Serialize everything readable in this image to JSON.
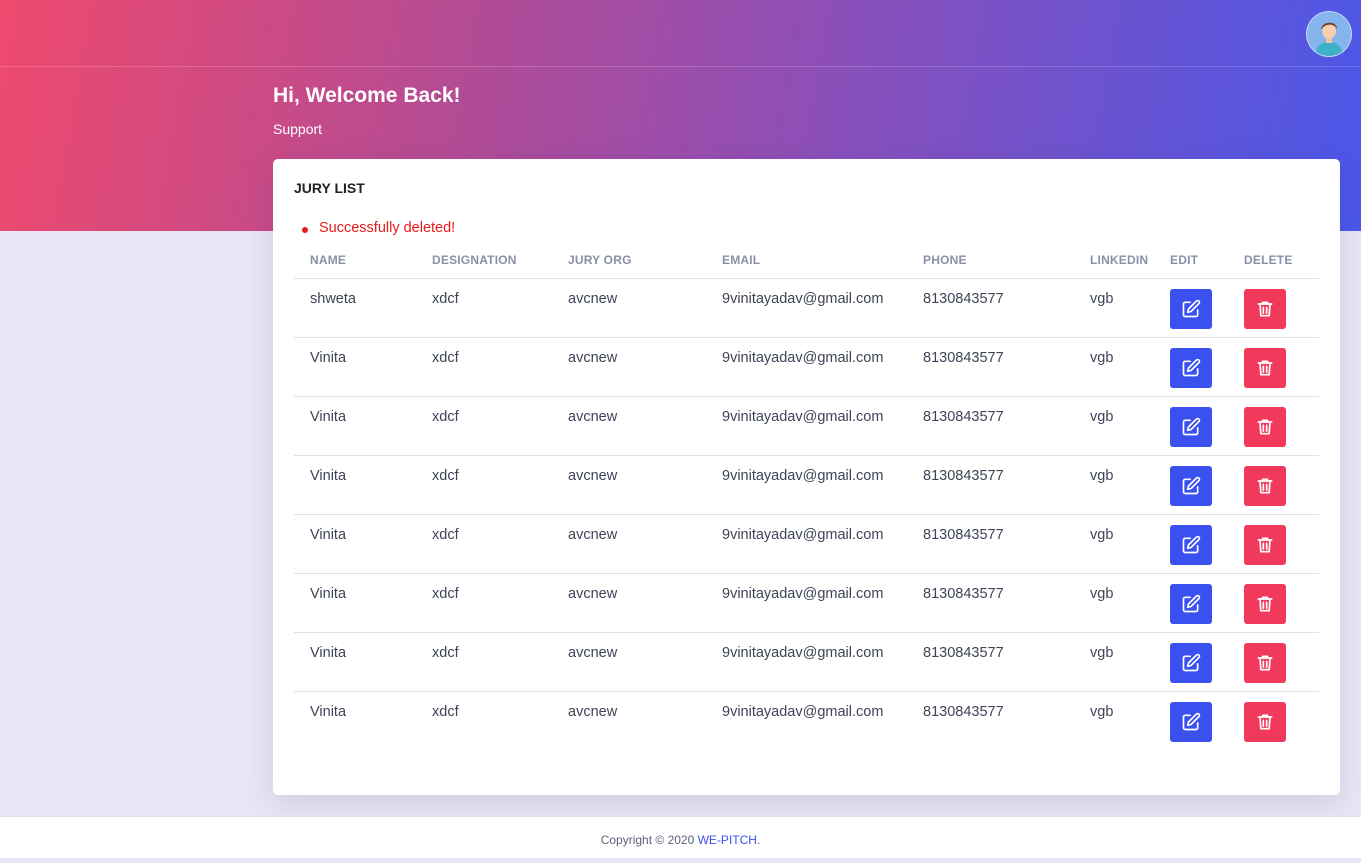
{
  "header": {
    "greeting": "Hi, Welcome Back!",
    "role": "Support"
  },
  "card": {
    "title": "JURY LIST",
    "alert": "Successfully deleted!"
  },
  "table": {
    "columns": [
      "NAME",
      "DESIGNATION",
      "JURY ORG",
      "EMAIL",
      "PHONE",
      "LINKEDIN",
      "EDIT",
      "DELETE"
    ],
    "rows": [
      {
        "name": "shweta",
        "designation": "xdcf",
        "org": "avcnew",
        "email": "9vinitayadav@gmail.com",
        "phone": "8130843577",
        "linkedin": "vgb"
      },
      {
        "name": "Vinita",
        "designation": "xdcf",
        "org": "avcnew",
        "email": "9vinitayadav@gmail.com",
        "phone": "8130843577",
        "linkedin": "vgb"
      },
      {
        "name": "Vinita",
        "designation": "xdcf",
        "org": "avcnew",
        "email": "9vinitayadav@gmail.com",
        "phone": "8130843577",
        "linkedin": "vgb"
      },
      {
        "name": "Vinita",
        "designation": "xdcf",
        "org": "avcnew",
        "email": "9vinitayadav@gmail.com",
        "phone": "8130843577",
        "linkedin": "vgb"
      },
      {
        "name": "Vinita",
        "designation": "xdcf",
        "org": "avcnew",
        "email": "9vinitayadav@gmail.com",
        "phone": "8130843577",
        "linkedin": "vgb"
      },
      {
        "name": "Vinita",
        "designation": "xdcf",
        "org": "avcnew",
        "email": "9vinitayadav@gmail.com",
        "phone": "8130843577",
        "linkedin": "vgb"
      },
      {
        "name": "Vinita",
        "designation": "xdcf",
        "org": "avcnew",
        "email": "9vinitayadav@gmail.com",
        "phone": "8130843577",
        "linkedin": "vgb"
      },
      {
        "name": "Vinita",
        "designation": "xdcf",
        "org": "avcnew",
        "email": "9vinitayadav@gmail.com",
        "phone": "8130843577",
        "linkedin": "vgb"
      }
    ]
  },
  "footer": {
    "copyright": "Copyright © 2020",
    "brand": "WE-PITCH",
    "suffix": "."
  },
  "icons": {
    "avatar": "user-avatar",
    "edit": "edit-icon",
    "delete": "trash-icon"
  },
  "colors": {
    "edit_button": "#3a50ef",
    "delete_button": "#f1395c",
    "alert": "#e81a1a"
  }
}
